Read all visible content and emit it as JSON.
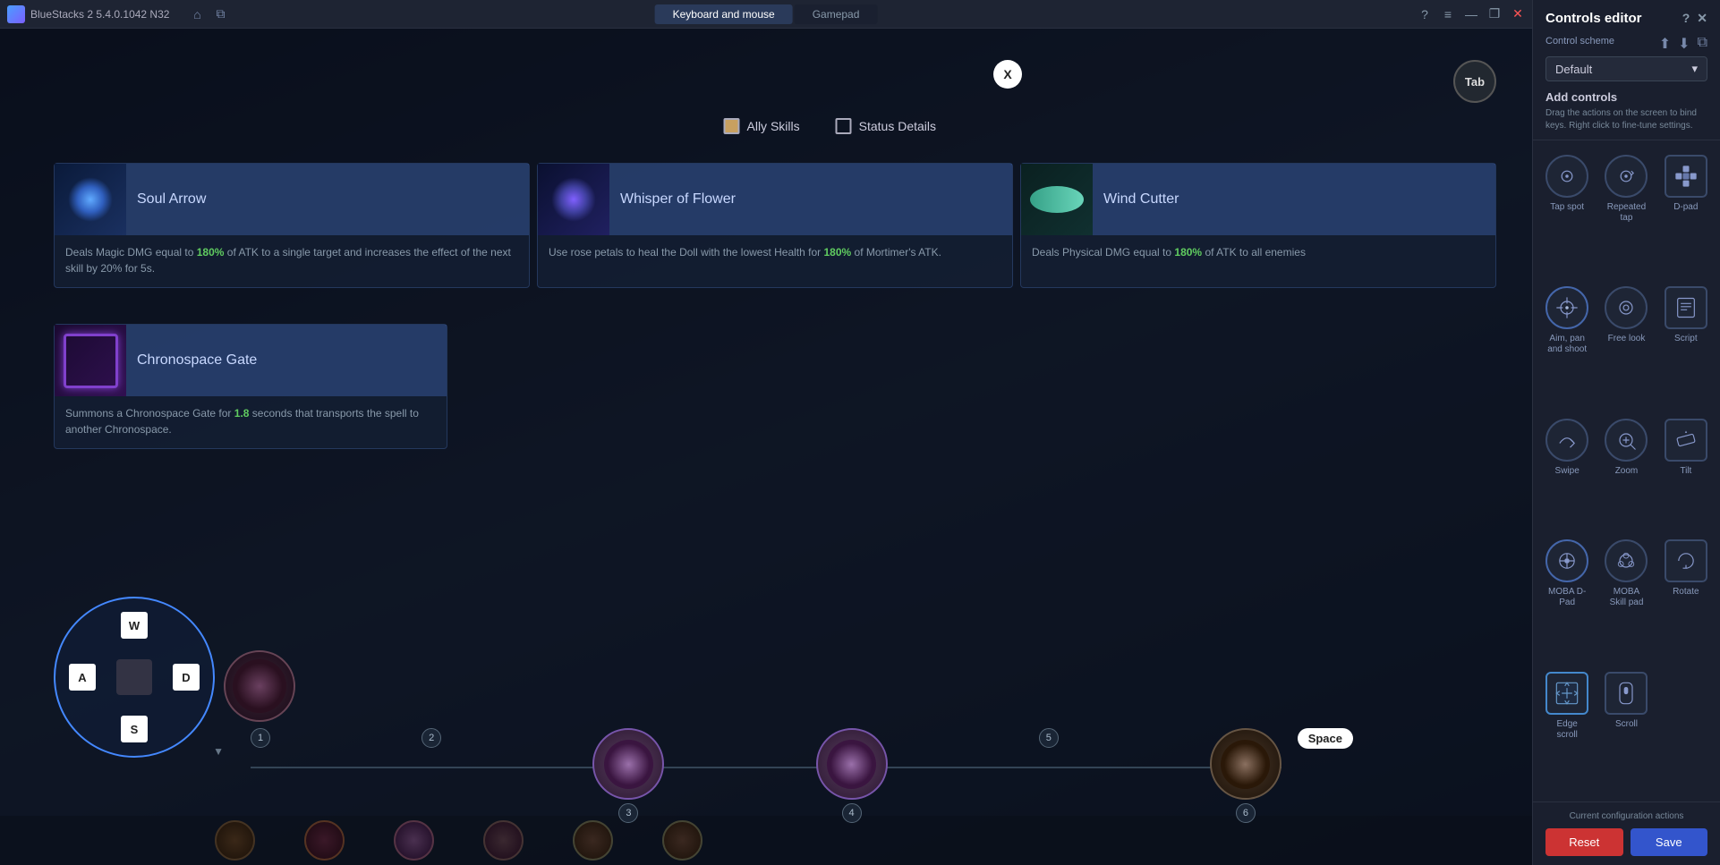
{
  "titlebar": {
    "app_name": "BlueStacks 2 5.4.0.1042 N32",
    "tabs": [
      {
        "id": "keyboard",
        "label": "Keyboard and mouse",
        "active": true
      },
      {
        "id": "gamepad",
        "label": "Gamepad",
        "active": false
      }
    ],
    "win_buttons": [
      "?",
      "—",
      "❐",
      "✕"
    ]
  },
  "game": {
    "x_button": "X",
    "tab_button": "Tab",
    "checkboxes": [
      {
        "id": "ally",
        "label": "Ally Skills",
        "checked": true
      },
      {
        "id": "status",
        "label": "Status Details",
        "checked": false
      }
    ]
  },
  "skills": [
    {
      "id": "soul-arrow",
      "title": "Soul Arrow",
      "icon_type": "soul-arrow",
      "desc_parts": [
        {
          "text": "Deals Magic DMG equal to ",
          "highlight": false
        },
        {
          "text": "180%",
          "highlight": true
        },
        {
          "text": " of ATK to a single target and increases the effect of the next skill by 20% for 5s.",
          "highlight": false
        }
      ]
    },
    {
      "id": "whisper-flower",
      "title": "Whisper of Flower",
      "icon_type": "whisper",
      "desc_parts": [
        {
          "text": "Use rose petals to heal the Doll with the lowest Health for ",
          "highlight": false
        },
        {
          "text": "180%",
          "highlight": true
        },
        {
          "text": " of Mortimer's ATK.",
          "highlight": false
        }
      ]
    },
    {
      "id": "wind-cutter",
      "title": "Wind Cutter",
      "icon_type": "wind-cutter",
      "desc_parts": [
        {
          "text": "Deals Physical DMG equal to ",
          "highlight": false
        },
        {
          "text": "180%",
          "highlight": true
        },
        {
          "text": " of ATK to all enemies",
          "highlight": false
        }
      ]
    }
  ],
  "skill_row2": [
    {
      "id": "chrono-gate",
      "title": "Chronospace Gate",
      "icon_type": "chrono-gate",
      "desc_parts": [
        {
          "text": "Summons a Chronospace Gate for ",
          "highlight": false
        },
        {
          "text": "1.8",
          "highlight": true
        },
        {
          "text": " seconds that transports the spell to another Chronospace.",
          "highlight": false
        }
      ]
    }
  ],
  "dpad": {
    "up": "W",
    "down": "S",
    "left": "A",
    "right": "D"
  },
  "space_key": "Space",
  "char_numbers": [
    "1",
    "2",
    "3",
    "4",
    "5",
    "6"
  ],
  "sidebar": {
    "title": "Controls editor",
    "close_icon": "✕",
    "help_icon": "?",
    "control_scheme_label": "Control scheme",
    "scheme_icons": [
      "↑",
      "↓",
      "⬆"
    ],
    "scheme_value": "Default",
    "add_controls_title": "Add controls",
    "add_controls_desc": "Drag the actions on the screen to bind keys. Right click to fine-tune settings.",
    "controls": [
      {
        "id": "tap-spot",
        "label": "Tap spot",
        "icon": "tap"
      },
      {
        "id": "repeated-tap",
        "label": "Repeated tap",
        "icon": "repeated"
      },
      {
        "id": "d-pad",
        "label": "D-pad",
        "icon": "dpad"
      },
      {
        "id": "aim-pan-shoot",
        "label": "Aim, pan and shoot",
        "icon": "aim"
      },
      {
        "id": "free-look",
        "label": "Free look",
        "icon": "freelook"
      },
      {
        "id": "script",
        "label": "Script",
        "icon": "script"
      },
      {
        "id": "swipe",
        "label": "Swipe",
        "icon": "swipe"
      },
      {
        "id": "zoom",
        "label": "Zoom",
        "icon": "zoom"
      },
      {
        "id": "tilt",
        "label": "Tilt",
        "icon": "tilt"
      },
      {
        "id": "moba-dpad",
        "label": "MOBA D-Pad",
        "icon": "moba-dpad"
      },
      {
        "id": "moba-skill-pad",
        "label": "MOBA Skill pad",
        "icon": "moba-skill"
      },
      {
        "id": "rotate",
        "label": "Rotate",
        "icon": "rotate"
      },
      {
        "id": "edge-scroll",
        "label": "Edge scroll",
        "icon": "edge-scroll"
      },
      {
        "id": "scroll",
        "label": "Scroll",
        "icon": "scroll"
      }
    ],
    "current_config_label": "Current configuration actions",
    "btn_reset": "Reset",
    "btn_save": "Save"
  },
  "colors": {
    "accent_blue": "#3355cc",
    "accent_red": "#cc3333",
    "highlight_green": "#60cc60",
    "dpad_blue": "#4488ff"
  }
}
